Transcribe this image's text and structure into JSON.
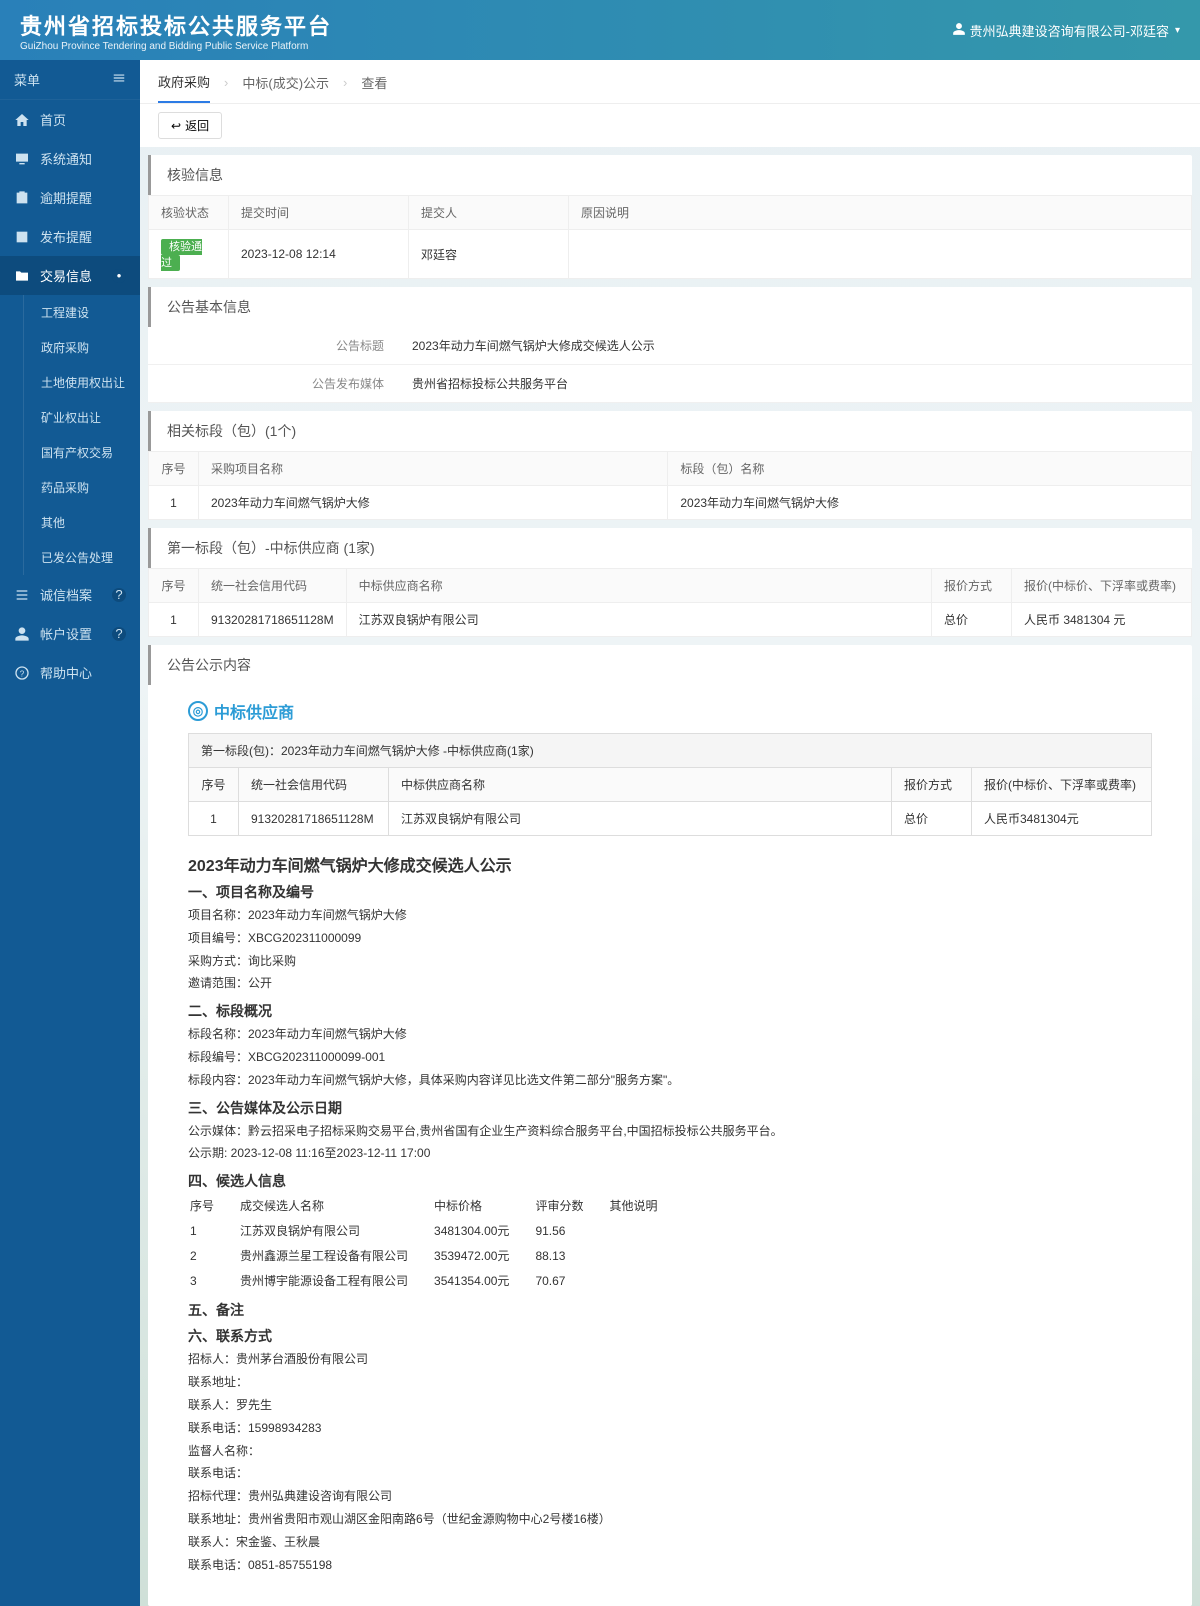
{
  "header": {
    "title_cn": "贵州省招标投标公共服务平台",
    "title_en": "GuiZhou Province Tendering and Bidding Public Service Platform",
    "user_label": "贵州弘典建设咨询有限公司-邓廷容"
  },
  "sidebar": {
    "menu_label": "菜单",
    "items": [
      {
        "label": "首页",
        "icon": "home"
      },
      {
        "label": "系统通知",
        "icon": "monitor"
      },
      {
        "label": "逾期提醒",
        "icon": "clock"
      },
      {
        "label": "发布提醒",
        "icon": "bell"
      },
      {
        "label": "交易信息",
        "icon": "folder",
        "active": true,
        "expand": true
      },
      {
        "label": "诚信档案",
        "icon": "list",
        "badge": true
      },
      {
        "label": "帐户设置",
        "icon": "user",
        "badge": true
      },
      {
        "label": "帮助中心",
        "icon": "help"
      }
    ],
    "sub_trade": [
      "工程建设",
      "政府采购",
      "土地使用权出让",
      "矿业权出让",
      "国有产权交易",
      "药品采购",
      "其他",
      "已发公告处理"
    ]
  },
  "breadcrumb": {
    "items": [
      "政府采购",
      "中标(成交)公示",
      "查看"
    ]
  },
  "toolbar": {
    "return_label": "返回"
  },
  "verify": {
    "title": "核验信息",
    "headers": [
      "核验状态",
      "提交时间",
      "提交人",
      "原因说明"
    ],
    "row": {
      "status": "核验通过",
      "time": "2023-12-08 12:14",
      "person": "邓廷容",
      "reason": ""
    }
  },
  "basic": {
    "title": "公告基本信息",
    "rows": [
      {
        "label": "公告标题",
        "value": "2023年动力车间燃气锅炉大修成交候选人公示"
      },
      {
        "label": "公告发布媒体",
        "value": "贵州省招标投标公共服务平台"
      }
    ]
  },
  "sections": {
    "title": "相关标段（包）(1个)",
    "headers": [
      "序号",
      "采购项目名称",
      "标段（包）名称"
    ],
    "row": {
      "idx": "1",
      "proj": "2023年动力车间燃气锅炉大修",
      "section": "2023年动力车间燃气锅炉大修"
    }
  },
  "winners": {
    "title": "第一标段（包）-中标供应商 (1家)",
    "headers": [
      "序号",
      "统一社会信用代码",
      "中标供应商名称",
      "报价方式",
      "报价(中标价、下浮率或费率)"
    ],
    "row": {
      "idx": "1",
      "code": "91320281718651128M",
      "name": "江苏双良锅炉有限公司",
      "mode": "总价",
      "price": "人民币 3481304 元"
    }
  },
  "content": {
    "title": "公告公示内容",
    "supplier_label": "中标供应商",
    "inner_caption": "第一标段(包)：2023年动力车间燃气锅炉大修  -中标供应商(1家)",
    "inner_headers": [
      "序号",
      "统一社会信用代码",
      "中标供应商名称",
      "报价方式",
      "报价(中标价、下浮率或费率)"
    ],
    "inner_row": {
      "idx": "1",
      "code": "91320281718651128M",
      "name": "江苏双良锅炉有限公司",
      "mode": "总价",
      "price": "人民币3481304元"
    },
    "announce": {
      "h2": "2023年动力车间燃气锅炉大修成交候选人公示",
      "s1_h": "一、项目名称及编号",
      "s1_l1": "项目名称：2023年动力车间燃气锅炉大修",
      "s1_l2": "项目编号：XBCG202311000099",
      "s1_l3": "采购方式：询比采购",
      "s1_l4": "邀请范围：公开",
      "s2_h": "二、标段概况",
      "s2_l1": "标段名称：2023年动力车间燃气锅炉大修",
      "s2_l2": "标段编号：XBCG202311000099-001",
      "s2_l3": "标段内容：2023年动力车间燃气锅炉大修，具体采购内容详见比选文件第二部分\"服务方案\"。",
      "s3_h": "三、公告媒体及公示日期",
      "s3_l1": "公示媒体：黔云招采电子招标采购交易平台,贵州省国有企业生产资料综合服务平台,中国招标投标公共服务平台。",
      "s3_l2": "公示期: 2023-12-08 11:16至2023-12-11 17:00",
      "s4_h": "四、候选人信息",
      "s4_headers": [
        "序号",
        "成交候选人名称",
        "中标价格",
        "评审分数",
        "其他说明"
      ],
      "s4_rows": [
        {
          "idx": "1",
          "name": "江苏双良锅炉有限公司",
          "price": "3481304.00元",
          "score": "91.56",
          "note": ""
        },
        {
          "idx": "2",
          "name": "贵州鑫源兰星工程设备有限公司",
          "price": "3539472.00元",
          "score": "88.13",
          "note": ""
        },
        {
          "idx": "3",
          "name": "贵州博宇能源设备工程有限公司",
          "price": "3541354.00元",
          "score": "70.67",
          "note": ""
        }
      ],
      "s5_h": "五、备注",
      "s6_h": "六、联系方式",
      "s6_l1": "招标人：贵州茅台酒股份有限公司",
      "s6_l2": "联系地址：",
      "s6_l3": "联系人：罗先生",
      "s6_l4": "联系电话：15998934283",
      "s6_l5": "监督人名称：",
      "s6_l6": "联系电话：",
      "s6_l7": "招标代理：贵州弘典建设咨询有限公司",
      "s6_l8": "联系地址：贵州省贵阳市观山湖区金阳南路6号（世纪金源购物中心2号楼16楼）",
      "s6_l9": "联系人：宋金鉴、王秋晨",
      "s6_l10": "联系电话：0851-85755198"
    }
  }
}
